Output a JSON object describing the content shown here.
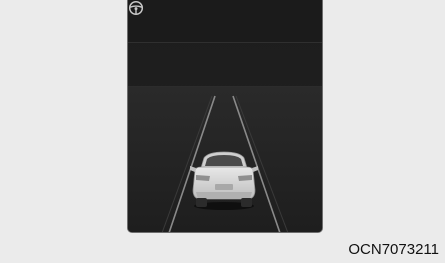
{
  "figure": {
    "code": "OCN7073211"
  },
  "cluster_display": {
    "icons": [
      "steering-wheel-icon"
    ],
    "elements": [
      "road-lane-lines",
      "vehicle-rear-view"
    ],
    "colors": {
      "page_background": "#ebebeb",
      "screen_background": "#1a1a1a",
      "lane_line": "#8a8a8a",
      "vehicle_body": "#d6d6d6"
    }
  }
}
